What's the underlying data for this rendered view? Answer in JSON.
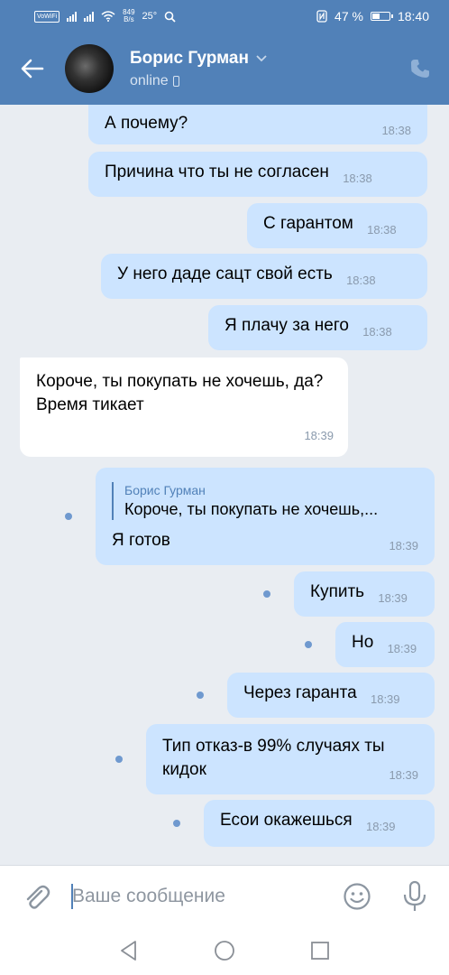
{
  "status_bar": {
    "volte": "VoWiFi",
    "speed_value": "849",
    "speed_unit": "B/s",
    "temperature": "25°",
    "battery": "47 %",
    "battery_level": 0.47,
    "time": "18:40",
    "icons": [
      "signal-icon",
      "wifi-icon",
      "search-icon",
      "nfc-icon",
      "battery-icon"
    ]
  },
  "header": {
    "contact_name": "Борис Гурман",
    "presence": "online",
    "icons": [
      "back-arrow-icon",
      "chevron-down-icon",
      "mobile-icon",
      "phone-icon"
    ]
  },
  "messages": [
    {
      "direction": "out",
      "text": "А почему?",
      "time": "18:38",
      "unread": false
    },
    {
      "direction": "out",
      "text": "Причина что ты не согласен",
      "time": "18:38",
      "unread": false
    },
    {
      "direction": "out",
      "text": "С гарантом",
      "time": "18:38",
      "unread": false
    },
    {
      "direction": "out",
      "text": "У него даде сацт свой есть",
      "time": "18:38",
      "unread": false
    },
    {
      "direction": "out",
      "text": "Я плачу за него",
      "time": "18:38",
      "unread": false
    },
    {
      "direction": "in",
      "text": "Короче, ты покупать не хочешь, да?\nВремя тикает",
      "time": "18:39",
      "unread": false
    },
    {
      "direction": "out",
      "reply_author": "Борис Гурман",
      "reply_text": "Короче, ты покупать не хочешь,...",
      "text": "Я готов",
      "time": "18:39",
      "unread": true
    },
    {
      "direction": "out",
      "text": "Купить",
      "time": "18:39",
      "unread": true
    },
    {
      "direction": "out",
      "text": "Но",
      "time": "18:39",
      "unread": true
    },
    {
      "direction": "out",
      "text": "Через гаранта",
      "time": "18:39",
      "unread": true
    },
    {
      "direction": "out",
      "text": "Тип отказ-в 99% случаях ты кидок",
      "time": "18:39",
      "unread": true
    },
    {
      "direction": "out",
      "text": "Есои окажешься",
      "time": "18:39",
      "unread": true
    }
  ],
  "composer": {
    "placeholder": "Ваше сообщение",
    "icons": [
      "paperclip-icon",
      "emoji-icon",
      "microphone-icon"
    ]
  },
  "nav_bar": {
    "icons": [
      "back-triangle-icon",
      "home-circle-icon",
      "recents-square-icon"
    ]
  },
  "colors": {
    "header": "#5181b8",
    "outgoing_bubble": "#cce4ff",
    "incoming_bubble": "#ffffff",
    "background": "#e9edf2",
    "timestamp": "#8a9aad",
    "unread_dot": "#6f99cf"
  }
}
